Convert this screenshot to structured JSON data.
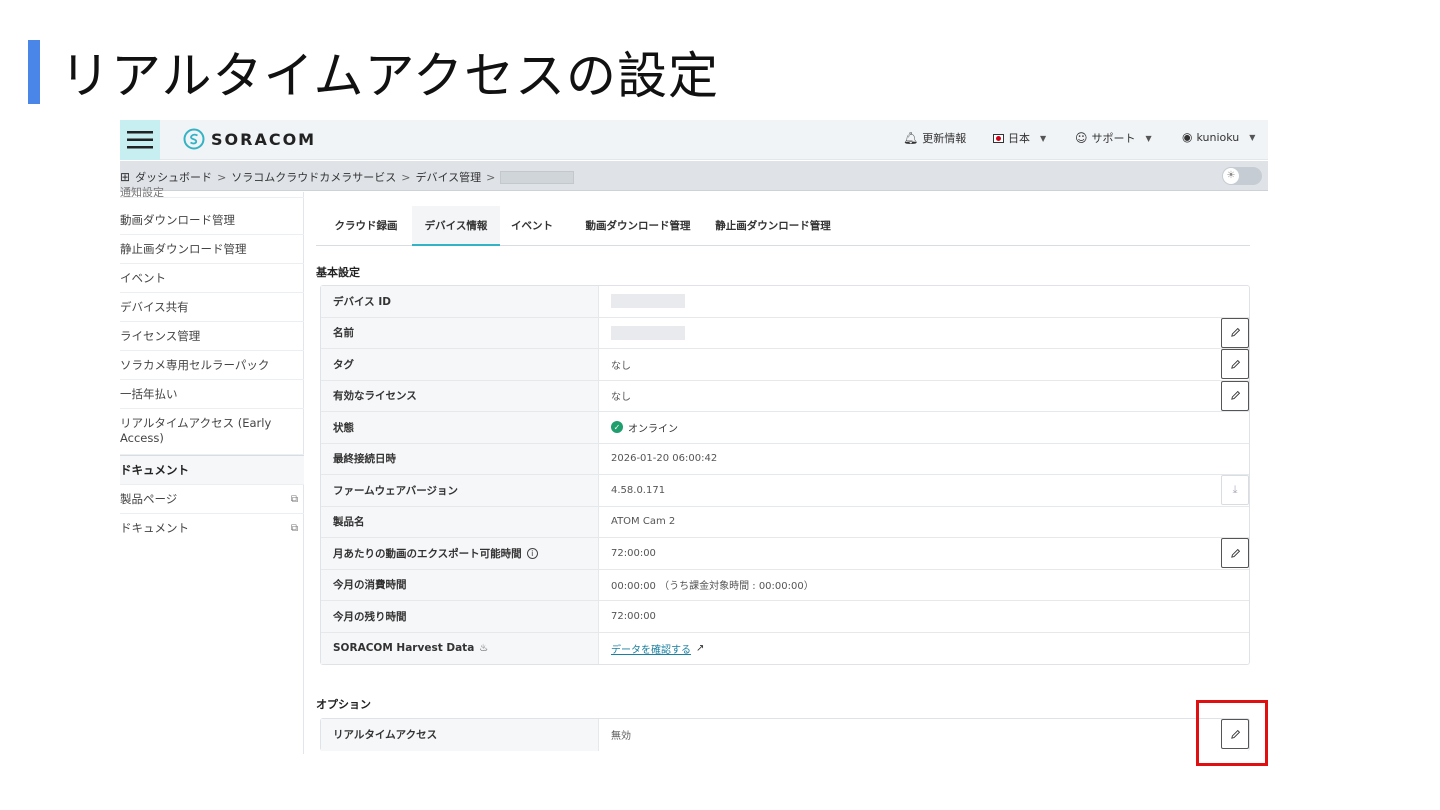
{
  "slide": {
    "title": "リアルタイムアクセスの設定"
  },
  "topbar": {
    "logo_text": "SORACOM",
    "news": "更新情報",
    "language": "日本",
    "support": "サポート",
    "user": "kunioku"
  },
  "breadcrumb": [
    "ダッシュボード",
    "ソラコムクラウドカメラサービス",
    "デバイス管理"
  ],
  "sidebar": {
    "cut_item": "通知設定",
    "items": [
      "動画ダウンロード管理",
      "静止画ダウンロード管理",
      "イベント",
      "デバイス共有",
      "ライセンス管理",
      "ソラカメ専用セルラーパック",
      "一括年払い",
      "リアルタイムアクセス (Early Access)"
    ],
    "section": "ドキュメント",
    "doc_items": [
      "製品ページ",
      "ドキュメント"
    ]
  },
  "tabs": [
    "クラウド録画",
    "デバイス情報",
    "イベント",
    "動画ダウンロード管理",
    "静止画ダウンロード管理"
  ],
  "active_tab": "デバイス情報",
  "basic": {
    "title": "基本設定",
    "rows": [
      {
        "label": "デバイス ID",
        "value": ""
      },
      {
        "label": "名前",
        "value": ""
      },
      {
        "label": "タグ",
        "value": "なし"
      },
      {
        "label": "有効なライセンス",
        "value": "なし"
      },
      {
        "label": "状態",
        "value": "オンライン"
      },
      {
        "label": "最終接続日時",
        "value": "2026-01-20 06:00:42"
      },
      {
        "label": "ファームウェアバージョン",
        "value": "4.58.0.171"
      },
      {
        "label": "製品名",
        "value": "ATOM Cam 2"
      },
      {
        "label": "月あたりの動画のエクスポート可能時間",
        "value": "72:00:00"
      },
      {
        "label": "今月の消費時間",
        "value": "00:00:00 （うち課金対象時間 : 00:00:00）"
      },
      {
        "label": "今月の残り時間",
        "value": "72:00:00"
      },
      {
        "label": "SORACOM Harvest Data",
        "value": "データを確認する"
      }
    ]
  },
  "options": {
    "title": "オプション",
    "rows": [
      {
        "label": "リアルタイムアクセス",
        "value": "無効"
      }
    ]
  },
  "colors": {
    "accent": "#34b3c4",
    "highlight": "#e01010",
    "slide_bar": "#4a86e8",
    "online": "#1f9e6e"
  },
  "icons": [
    "hamburger-icon",
    "soracom-logo-icon",
    "bell-icon",
    "flag-jp-icon",
    "support-icon",
    "user-icon",
    "dashboard-icon",
    "theme-toggle-icon",
    "external-link-icon",
    "pencil-icon",
    "download-icon",
    "check-circle-icon",
    "info-icon",
    "harvest-icon",
    "arrow-up-right-icon"
  ]
}
